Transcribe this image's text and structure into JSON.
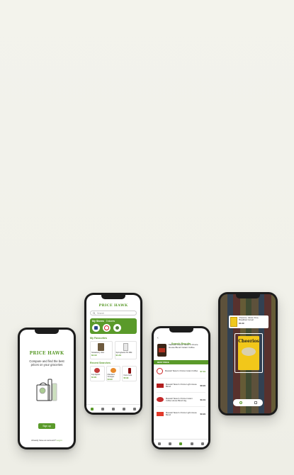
{
  "phone1": {
    "brand": "PRICE HAWK",
    "headline": "Compare and find the best prices on your groceries",
    "signup_label": "Sign up",
    "login_prompt": "Already have an account?",
    "login_link": "Log in"
  },
  "phone2": {
    "brand": "PRICE HAWK",
    "search_placeholder": "Search",
    "my_stores_label": "My Stores",
    "stores_count": "3 stores",
    "my_favourites_label": "My Favourites",
    "favourites": [
      {
        "name": "Strawberry Jam",
        "price": "$2.99"
      },
      {
        "name": "Springbank 2% Milk",
        "price": "$4.49"
      }
    ],
    "recent_searches_label": "Recent Searches",
    "recent": [
      {
        "name": "Fuji Apples",
        "price": "$4.99"
      },
      {
        "name": "Mandarin Oranges",
        "price": "$3.99"
      },
      {
        "name": "Coca Cola",
        "price": "$5.99"
      }
    ]
  },
  "phone3": {
    "title": "Search Results",
    "query_product": "Maxwell House Taster's Choice House Blend Instant Coffee",
    "best_price_label": "BEST PRICE",
    "results": [
      {
        "name": "Maxwell Taster's Choice Instant Coffee",
        "price": "$7.49"
      },
      {
        "name": "Maxwell Taster's Choice Light House Blend",
        "price": "$8.99"
      },
      {
        "name": "Maxwell Taster's Choice Instant Coffee House Blend 1kg",
        "price": "$9.49"
      },
      {
        "name": "Maxwell Taster's Choice Light House Blend",
        "price": "$9.99"
      }
    ]
  },
  "phone4": {
    "scan_product_name": "Cheerios, Gluten Free, Breakfast Cereal",
    "scan_price": "$4.99",
    "box_brand": "Cheerios"
  },
  "colors": {
    "brand_green": "#5a9a2a",
    "target_red": "#cc1f1f",
    "background": "#f2f2eb"
  }
}
